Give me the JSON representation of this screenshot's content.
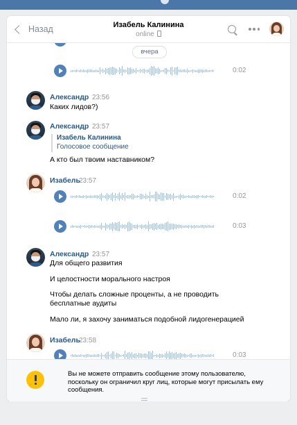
{
  "header": {
    "back_label": "Назад",
    "peer_name": "Изабель Калинина",
    "peer_status": "online"
  },
  "date_divider": "вчера",
  "messages": [
    {
      "author": "Александр",
      "time": "23:56",
      "text": "Каких лидов?)"
    },
    {
      "author": "Александр",
      "time": "23:57",
      "quote_author": "Изабель Калинина",
      "quote_text": "Голосовое сообщение",
      "text": "А кто был твоим наставником?"
    },
    {
      "author": "Изабель",
      "time": "23:57"
    },
    {
      "author": "Александр",
      "time": "23:57",
      "lines": [
        "Для общего развития",
        "И целостности морального настроя",
        "Чтобы делать сложные проценты, а не проводить бесплатные аудиты",
        "Мало ли, я захочу заниматься подобной лидогенерацией"
      ]
    },
    {
      "author": "Изабель",
      "time": "23:58"
    }
  ],
  "voice_durations": [
    "0:02",
    "0:02",
    "0:03",
    "0:03"
  ],
  "notice": {
    "text": "Вы не можете отправить сообщение этому пользователю, поскольку он ограничил круг лиц, которые могут присылать ему сообщения."
  },
  "icons": {
    "back": "chevron-left-icon",
    "search": "search-icon",
    "more": "more-dots-icon",
    "play": "play-icon",
    "warning": "warning-icon",
    "device": "phone-icon"
  },
  "colors": {
    "accent": "#5181b8",
    "link": "#2a5885",
    "warning": "#ffc107",
    "topbar": "#4a76a8"
  }
}
